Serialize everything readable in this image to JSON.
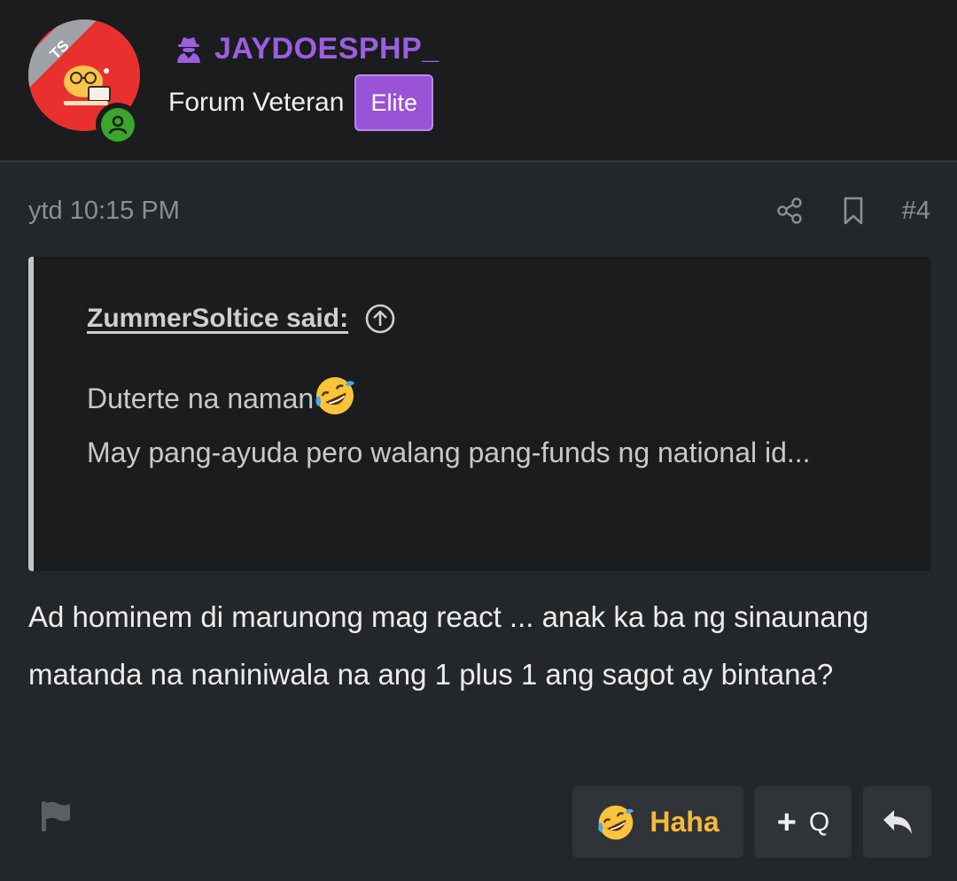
{
  "author": {
    "avatar_badge": "TS",
    "username": "JAYDOESPHP_",
    "user_title": "Forum Veteran",
    "badge": "Elite",
    "online": true,
    "username_color": "#9b5fe0"
  },
  "post": {
    "timestamp": "ytd 10:15 PM",
    "number": "#4",
    "quote": {
      "author": "ZummerSoltice said:",
      "line1": "Duterte na naman",
      "line2": "May pang-ayuda pero walang pang-funds ng national id..."
    },
    "message": "Ad hominem di marunong mag react ... anak ka ba ng sinaunang matanda na naniniwala na ang 1 plus 1 ang sagot ay bintana?"
  },
  "actions": {
    "reaction_label": "Haha",
    "quote_plus": "+",
    "quote_label": "Q"
  },
  "icons": {
    "share": "share-icon",
    "bookmark": "bookmark-icon",
    "jump": "arrow-up-circle-icon",
    "flag": "flag-icon",
    "reply": "reply-icon",
    "reaction": "rofl-emoji-icon",
    "spy": "user-secret-icon"
  }
}
